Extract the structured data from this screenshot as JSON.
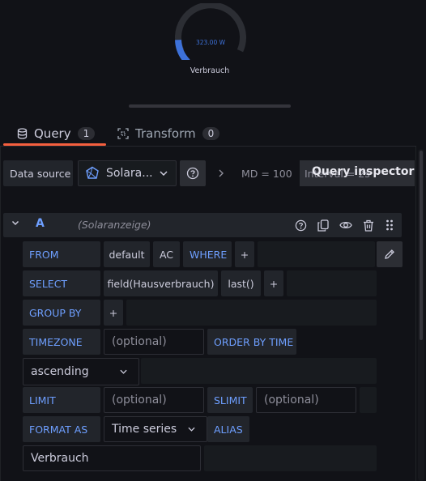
{
  "gauge": {
    "value": "323.00 W",
    "title": "Verbrauch",
    "fill_fraction": 0.16,
    "color": "#3d71d9"
  },
  "tabs": [
    {
      "label": "Query",
      "count": "1",
      "icon": "database-icon"
    },
    {
      "label": "Transform",
      "count": "0",
      "icon": "transform-icon"
    }
  ],
  "toolbar": {
    "datasource_label": "Data source",
    "datasource_value": "Solara...",
    "options_summary": "MD = 100",
    "query_inspector_label": "Query inspector",
    "interval_label": "Interval = 2s"
  },
  "query": {
    "ref_id": "A",
    "datasource": "(Solaranzeige)",
    "from": {
      "keyword": "FROM",
      "policy": "default",
      "measurement": "AC",
      "where": "WHERE",
      "add": "+"
    },
    "select": {
      "keyword": "SELECT",
      "field": "field(Hausverbrauch)",
      "func": "last()",
      "add": "+"
    },
    "group_by": {
      "keyword": "GROUP BY",
      "add": "+"
    },
    "timezone": {
      "keyword": "TIMEZONE",
      "placeholder": "(optional)"
    },
    "order_by": {
      "keyword": "ORDER BY TIME",
      "value": "ascending"
    },
    "limit": {
      "keyword": "LIMIT",
      "placeholder": "(optional)"
    },
    "slimit": {
      "keyword": "SLIMIT",
      "placeholder": "(optional)"
    },
    "format_as": {
      "keyword": "FORMAT AS",
      "value": "Time series"
    },
    "alias": {
      "keyword": "ALIAS",
      "value": "Verbrauch"
    }
  },
  "colors": {
    "accent": "#6e9fff",
    "tab_underline": "#f55f3e",
    "background": "#111217"
  }
}
